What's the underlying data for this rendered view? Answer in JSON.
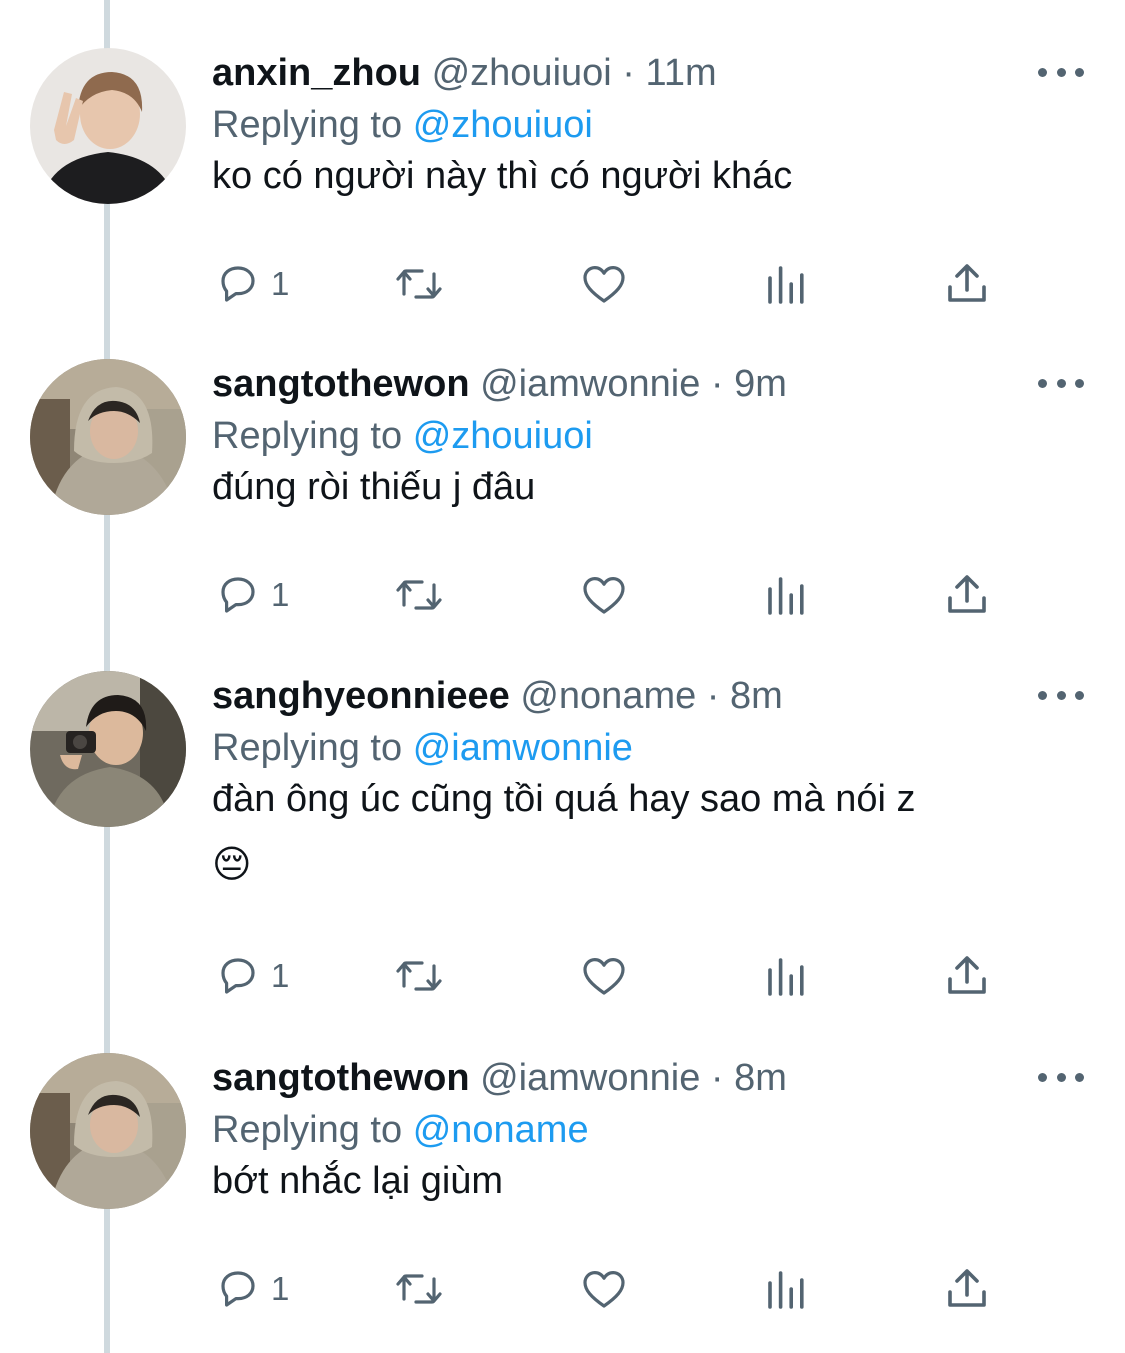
{
  "tweets": [
    {
      "name": "anxin_zhou",
      "handle": "@zhouiuoi",
      "separator": "·",
      "time": "11m",
      "replying_prefix": "Replying to",
      "replying_to": "@zhouiuoi",
      "text": "ko có người này thì có người khác",
      "emoji": "",
      "reply_count": "1"
    },
    {
      "name": "sangtothewon",
      "handle": "@iamwonnie",
      "separator": "·",
      "time": "9m",
      "replying_prefix": "Replying to",
      "replying_to": "@zhouiuoi",
      "text": "đúng ròi thiếu j đâu",
      "emoji": "",
      "reply_count": "1"
    },
    {
      "name": "sanghyeonnieee",
      "handle": "@noname",
      "separator": "·",
      "time": "8m",
      "replying_prefix": "Replying to",
      "replying_to": "@iamwonnie",
      "text": "đàn ông úc cũng tồi quá hay sao mà nói z",
      "emoji": "😔",
      "reply_count": "1"
    },
    {
      "name": "sangtothewon",
      "handle": "@iamwonnie",
      "separator": "·",
      "time": "8m",
      "replying_prefix": "Replying to",
      "replying_to": "@noname",
      "text": "bớt nhắc lại giùm",
      "emoji": "",
      "reply_count": "1"
    }
  ],
  "icons": {
    "reply": "reply-icon",
    "retweet": "retweet-icon",
    "like": "heart-icon",
    "views": "analytics-icon",
    "share": "share-icon",
    "more": "more-icon"
  },
  "colors": {
    "text": "#0f1419",
    "secondary": "#536471",
    "mention": "#1d9bf0",
    "thread_line": "#cfd9de"
  }
}
